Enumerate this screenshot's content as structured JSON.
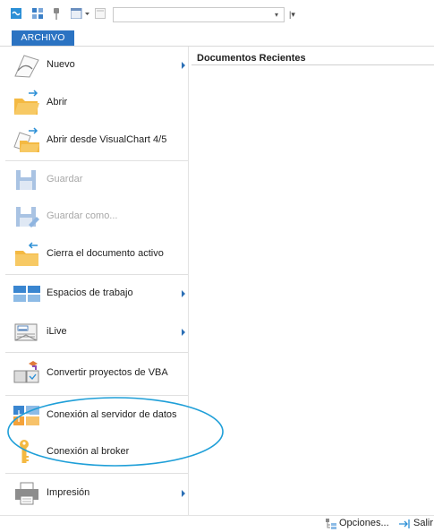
{
  "toolbar": {
    "icons": [
      "link-icon",
      "grid-icon",
      "pin-icon",
      "window-dropdown-icon",
      "page-icon"
    ],
    "combo_value": "",
    "combo_arrow": "▾",
    "overflow_arrow": "|▾"
  },
  "file_tab": {
    "label": "ARCHIVO"
  },
  "menu": {
    "items": [
      {
        "label": "Nuevo",
        "icon": "new-document-icon",
        "submenu": true,
        "enabled": true
      },
      {
        "label": "Abrir",
        "icon": "open-folder-icon",
        "submenu": false,
        "enabled": true
      },
      {
        "label": "Abrir desde VisualChart 4/5",
        "icon": "open-legacy-icon",
        "submenu": false,
        "enabled": true
      },
      {
        "label": "Guardar",
        "icon": "save-icon",
        "submenu": false,
        "enabled": false
      },
      {
        "label": "Guardar como...",
        "icon": "save-as-icon",
        "submenu": false,
        "enabled": false
      },
      {
        "label": "Cierra el documento activo",
        "icon": "close-document-icon",
        "submenu": false,
        "enabled": true
      },
      {
        "label": "Espacios de trabajo",
        "icon": "workspace-icon",
        "submenu": true,
        "enabled": true
      },
      {
        "label": "iLive",
        "icon": "news-icon",
        "submenu": true,
        "enabled": true
      },
      {
        "label": "Convertir proyectos de VBA",
        "icon": "convert-vba-icon",
        "submenu": false,
        "enabled": true
      },
      {
        "label": "Conexión al servidor de datos",
        "icon": "data-server-icon",
        "submenu": false,
        "enabled": true
      },
      {
        "label": "Conexión al broker",
        "icon": "broker-key-icon",
        "submenu": false,
        "enabled": true
      },
      {
        "label": "Impresión",
        "icon": "printer-icon",
        "submenu": true,
        "enabled": true
      }
    ]
  },
  "recent": {
    "title": "Documentos Recientes"
  },
  "footer": {
    "options_label": "Opciones...",
    "exit_label": "Salir"
  },
  "colors": {
    "accent": "#2b73c2",
    "annotation": "#1f9fd8",
    "folder": "#f4b942",
    "disabled": "#a8a8a8"
  }
}
